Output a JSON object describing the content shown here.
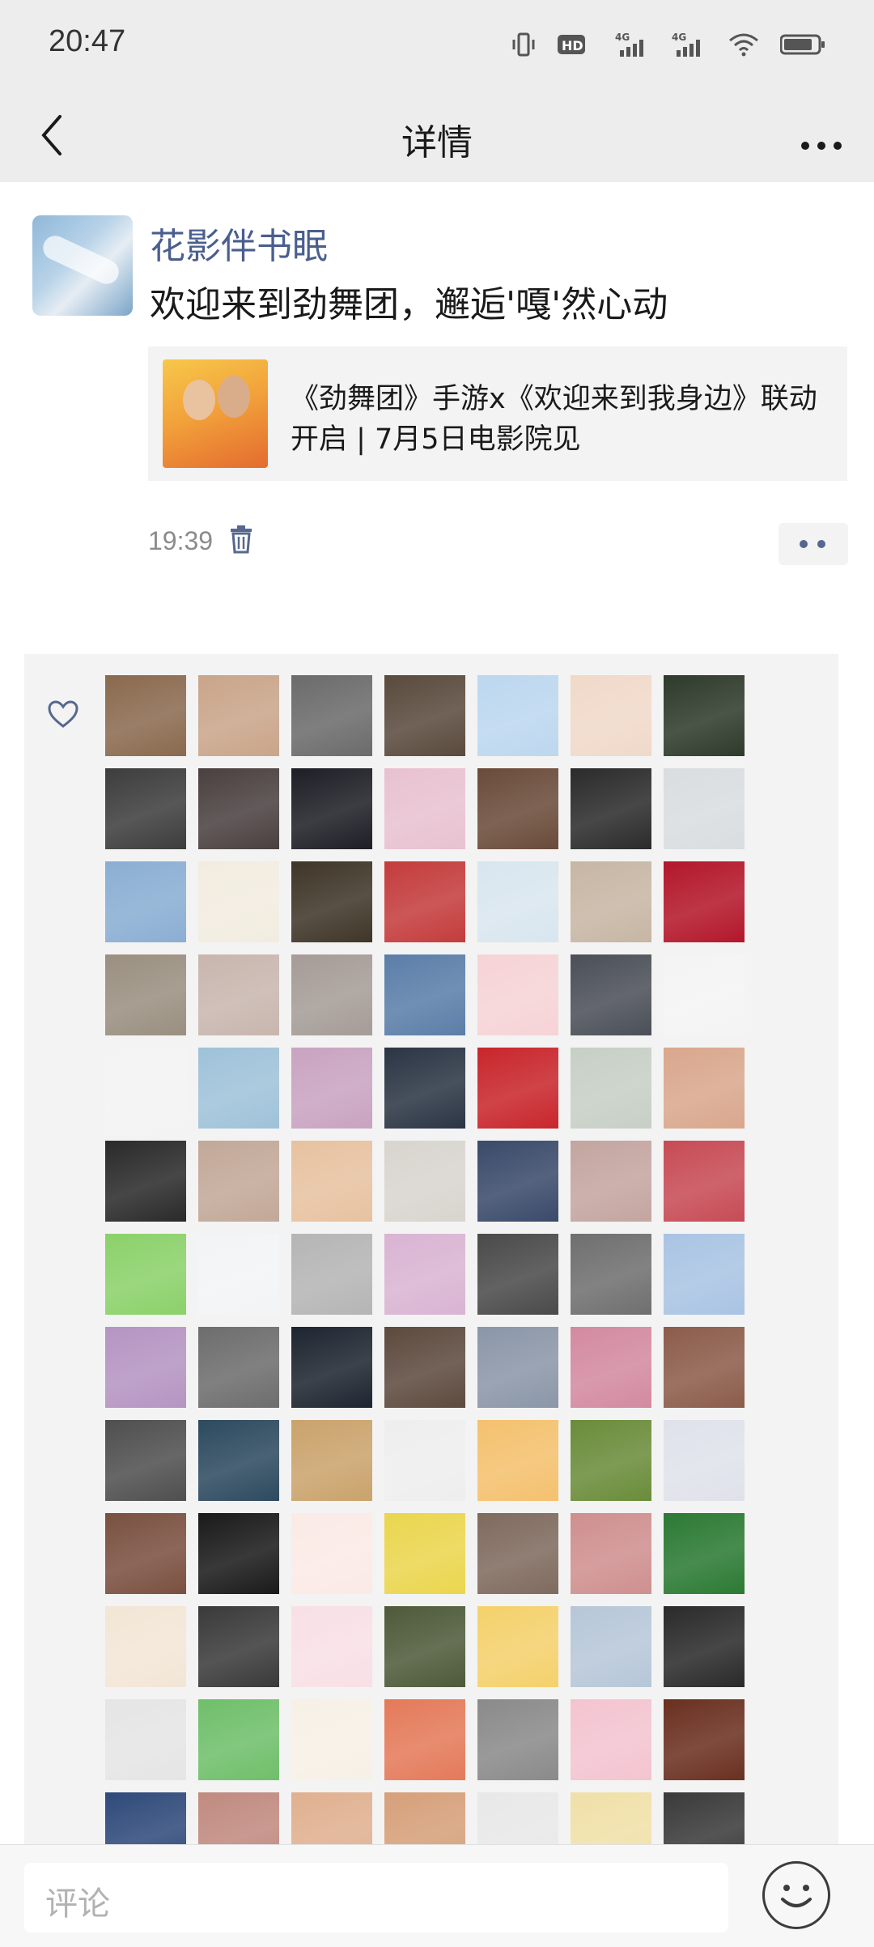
{
  "status_bar": {
    "time": "20:47",
    "icons": [
      "vibrate-icon",
      "hd-icon",
      "signal-4g-icon",
      "signal-4g-icon",
      "wifi-icon",
      "battery-icon"
    ]
  },
  "nav": {
    "title": "详情",
    "back_icon": "chevron-left-icon",
    "more_icon": "more-dots-icon"
  },
  "post": {
    "author": "花影伴书眠",
    "text": "欢迎来到劲舞团，邂逅'嘎'然心动",
    "share": {
      "title": "《劲舞团》手游x《欢迎来到我身边》联动开启 | 7月5日电影院见"
    },
    "time": "19:39"
  },
  "likes": {
    "avatar_colors": [
      [
        "#8a6a4f",
        "#c9a58a",
        "#6b6b6b",
        "#5a4a3d",
        "#bcd7ef",
        "#f0d9c9",
        "#2e3a2b"
      ],
      [
        "#3d3d3d",
        "#4a4040",
        "#1e1e26",
        "#e8c1d0",
        "#6a4b3a",
        "#2b2b2b",
        "#d9dde0"
      ],
      [
        "#8aaed3",
        "#f2ece0",
        "#3f3528",
        "#c43c3c",
        "#d9e6ef",
        "#c7b6a4",
        "#b3172a"
      ],
      [
        "#9a8f80",
        "#c8b6ae",
        "#a59c97",
        "#5b7ea8",
        "#f6d3d6",
        "#4b4f57",
        "#f4f4f4"
      ],
      [
        "#f3f3f3",
        "#9fc2d9",
        "#c9a3c1",
        "#2b3544",
        "#c8262b",
        "#c7cfc6",
        "#d9a78d"
      ],
      [
        "#2a2a2a",
        "#c2a898",
        "#e7c2a0",
        "#d8d5cf",
        "#3a4a6a",
        "#c4a5a0",
        "#c74b55"
      ],
      [
        "#8bd16a",
        "#f2f4f6",
        "#b5b5b5",
        "#d9b4d3",
        "#4a4a4a",
        "#6f6f6f",
        "#a9c4e3"
      ],
      [
        "#b594c2",
        "#6d6d6d",
        "#1d2530",
        "#5d4a3e",
        "#8b96a8",
        "#d38aa0",
        "#8c5c4a"
      ],
      [
        "#4f4f4f",
        "#2d4a5f",
        "#caa36c",
        "#eeeeee",
        "#f4c16e",
        "#6a8c3a",
        "#dfe2ea"
      ],
      [
        "#7a5040",
        "#1a1a1a",
        "#fbeae6",
        "#ead64e",
        "#7f6a5e",
        "#cf8f8f",
        "#2b7a33"
      ],
      [
        "#f2e6d6",
        "#3a3a3a",
        "#f8e0e6",
        "#4e5a3a",
        "#f4d16c",
        "#b7c7d8",
        "#2a2a2a"
      ],
      [
        "#e5e5e5",
        "#6fbf6a",
        "#f7f0e6",
        "#e47a5a",
        "#8a8a8a",
        "#f3c4d0",
        "#6a3020"
      ],
      [
        "#2f4a7a",
        "#c08a80",
        "#e0b090",
        "#d6a07a",
        "#e8e8e8",
        "#f0e0a8",
        "#3a3a3a"
      ]
    ]
  },
  "comment_bar": {
    "placeholder": "评论",
    "emoji_icon": "smiley-icon"
  }
}
